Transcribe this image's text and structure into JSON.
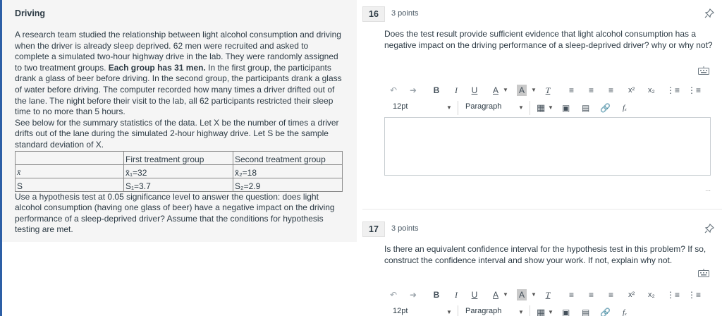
{
  "left": {
    "title": "Driving",
    "para1_a": "A research team studied the relationship between light alcohol consumption and driving when the driver is already sleep deprived. 62 men were recruited and asked to complete a simulated two-hour highway drive in the lab. They were randomly assigned to two treatment groups. ",
    "para1_bold": "Each group has 31 men.",
    "para1_b": " In the first group, the participants drank a glass of beer before driving. In the second group, the participants drank a glass of water before driving. The computer recorded how many times a driver drifted out of the lane. The night before their visit to the lab, all 62 participants restricted their sleep time to no more than 5 hours.",
    "para2": "See below for the summary statistics of the data. Let X be the number of times a driver drifts out of the lane during the simulated 2-hour highway drive. Let S be the sample standard deviation of X.",
    "table": {
      "header": [
        "",
        "First treatment group",
        "Second treatment group"
      ],
      "row_mean": [
        "x̄",
        "x̄₁=32",
        "x̄₂=18"
      ],
      "row_sd": [
        "S",
        "S₁=3.7",
        "S₂=2.9"
      ]
    },
    "para3": "Use a hypothesis test at 0.05 significance level to answer the question: does light alcohol consumption (having one glass of beer) have a negative impact on the driving performance of a sleep-deprived driver? Assume that the conditions for hypothesis testing are met."
  },
  "questions": [
    {
      "number": "16",
      "points": "3 points",
      "text": "Does the test result provide sufficient evidence that light alcohol consumption has a negative impact on the driving performance of a sleep-deprived driver? why or why not?"
    },
    {
      "number": "17",
      "points": "3 points",
      "text": "Is there an equivalent confidence interval for the hypothesis test in this problem? If so, construct the confidence interval and show your work. If not, explain why not."
    }
  ],
  "toolbar": {
    "bold": "B",
    "italic": "I",
    "underline": "U",
    "font_color": "A",
    "highlight": "A",
    "clear_format": "T",
    "superscript": "x²",
    "subscript": "x₂",
    "font_size": "12pt",
    "block_format": "Paragraph",
    "formula": "fₓ"
  },
  "colors": {
    "accent": "#2d5fa6",
    "panel_bg": "#f5f5f5",
    "text": "#2d3b45"
  }
}
